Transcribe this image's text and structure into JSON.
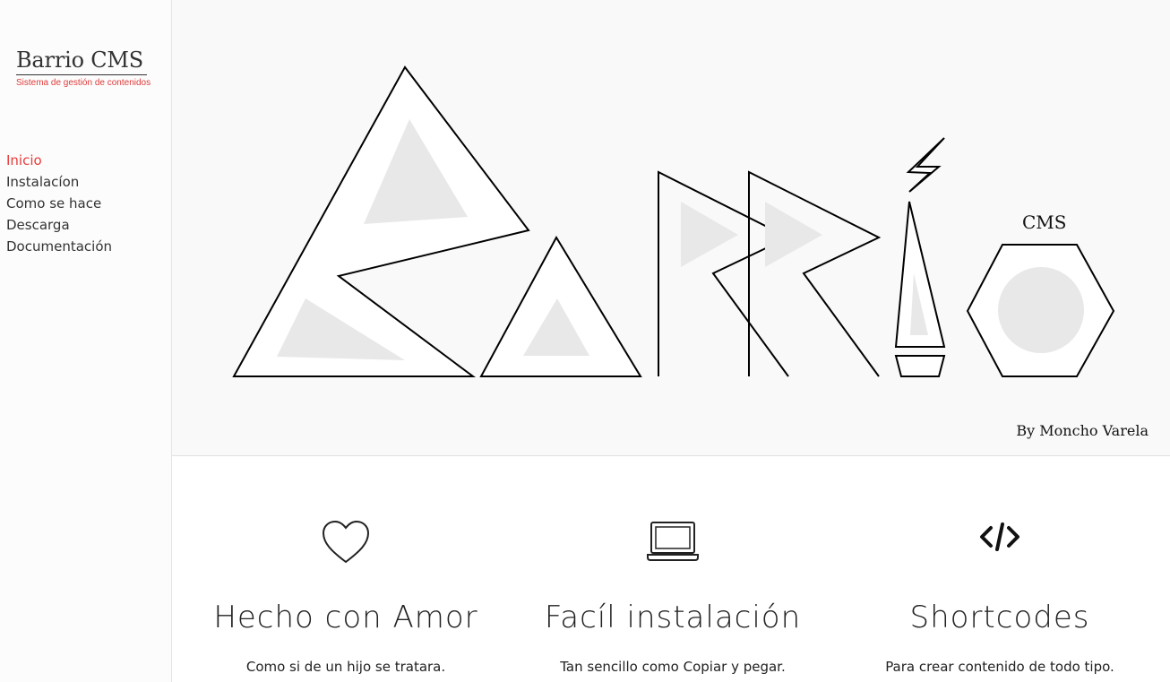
{
  "sidebar": {
    "brand_title": "Barrio CMS",
    "brand_subtitle": "Sistema de gestión de contenidos",
    "nav": [
      {
        "label": "Inicio",
        "active": true
      },
      {
        "label": "Instalacíon",
        "active": false
      },
      {
        "label": "Como se hace",
        "active": false
      },
      {
        "label": "Descarga",
        "active": false
      },
      {
        "label": "Documentación",
        "active": false
      }
    ]
  },
  "hero": {
    "logo_word": "BARRIO",
    "cms_label": "CMS",
    "byline": "By Moncho Varela"
  },
  "features": [
    {
      "icon": "heart-icon",
      "title": "Hecho con Amor",
      "text": "Como si de un hijo se tratara."
    },
    {
      "icon": "laptop-icon",
      "title": "Facíl instalación",
      "text": "Tan sencillo como Copiar y pegar."
    },
    {
      "icon": "code-icon",
      "title": "Shortcodes",
      "text": "Para crear contenido de todo tipo."
    }
  ],
  "colors": {
    "accent": "#e83b3b",
    "hero_bg": "#f9f9f9",
    "shape_fill": "#e8e8e8"
  }
}
